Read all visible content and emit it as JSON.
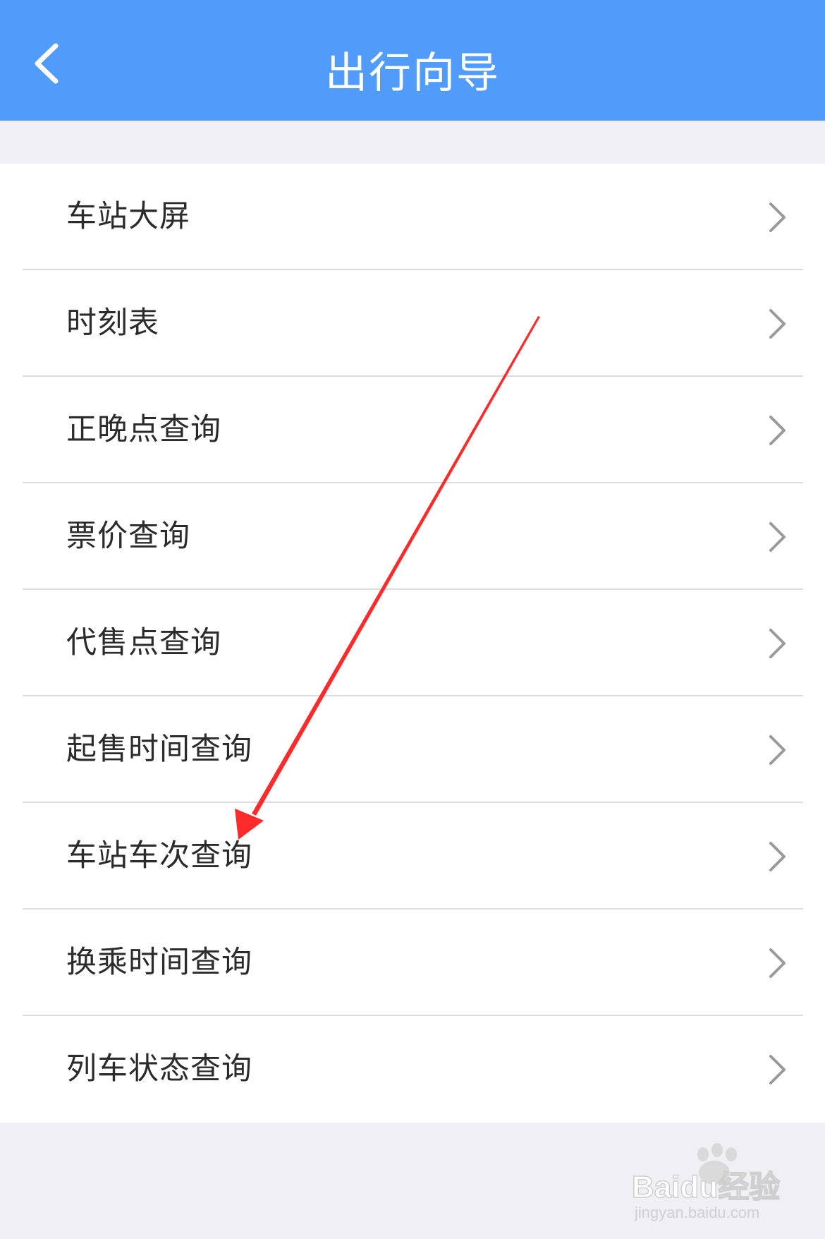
{
  "header": {
    "title": "出行向导",
    "back_icon": "chevron-left-icon",
    "background_color": "#519cfb"
  },
  "menu": {
    "items": [
      {
        "label": "车站大屏",
        "icon": "chevron-right-icon"
      },
      {
        "label": "时刻表",
        "icon": "chevron-right-icon"
      },
      {
        "label": "正晚点查询",
        "icon": "chevron-right-icon"
      },
      {
        "label": "票价查询",
        "icon": "chevron-right-icon"
      },
      {
        "label": "代售点查询",
        "icon": "chevron-right-icon"
      },
      {
        "label": "起售时间查询",
        "icon": "chevron-right-icon"
      },
      {
        "label": "车站车次查询",
        "icon": "chevron-right-icon"
      },
      {
        "label": "换乘时间查询",
        "icon": "chevron-right-icon"
      },
      {
        "label": "列车状态查询",
        "icon": "chevron-right-icon"
      }
    ]
  },
  "annotation": {
    "arrow_color": "#ff2a2a",
    "points_to": "车站车次查询"
  },
  "watermark": {
    "brand": "Baidu经验",
    "url": "jingyan.baidu.com"
  }
}
